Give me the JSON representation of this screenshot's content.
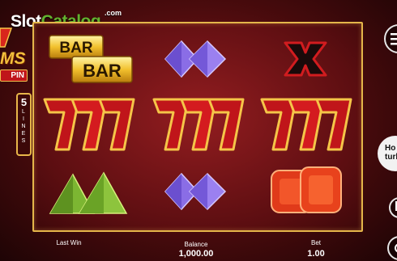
{
  "watermark": {
    "text_main": "Slot",
    "text_accent": "Catalog",
    "suffix": ".com"
  },
  "game_brand": {
    "title_fragment": "MS",
    "subtitle_fragment": "PIN",
    "lines_count": "5",
    "lines_word": "LINES"
  },
  "reels": [
    [
      "bar-bar",
      "seven-triple",
      "green-triangles"
    ],
    [
      "purple-diamonds",
      "seven-triple",
      "purple-diamonds"
    ],
    [
      "red-x",
      "seven-triple",
      "red-gems"
    ]
  ],
  "bar_symbol": {
    "top": "BAR",
    "bottom": "BAR"
  },
  "footer": {
    "last_win_label": "Last Win",
    "balance_label": "Balance",
    "balance_value": "1,000.00",
    "bet_label": "Bet",
    "bet_value": "1.00"
  },
  "side_controls": {
    "turbo_label_line1": "Ho",
    "turbo_label_line2": "turb"
  },
  "colors": {
    "frame_gold": "#e4b64a",
    "seven_red": "#c0151a",
    "watermark_green": "#63b22f"
  }
}
